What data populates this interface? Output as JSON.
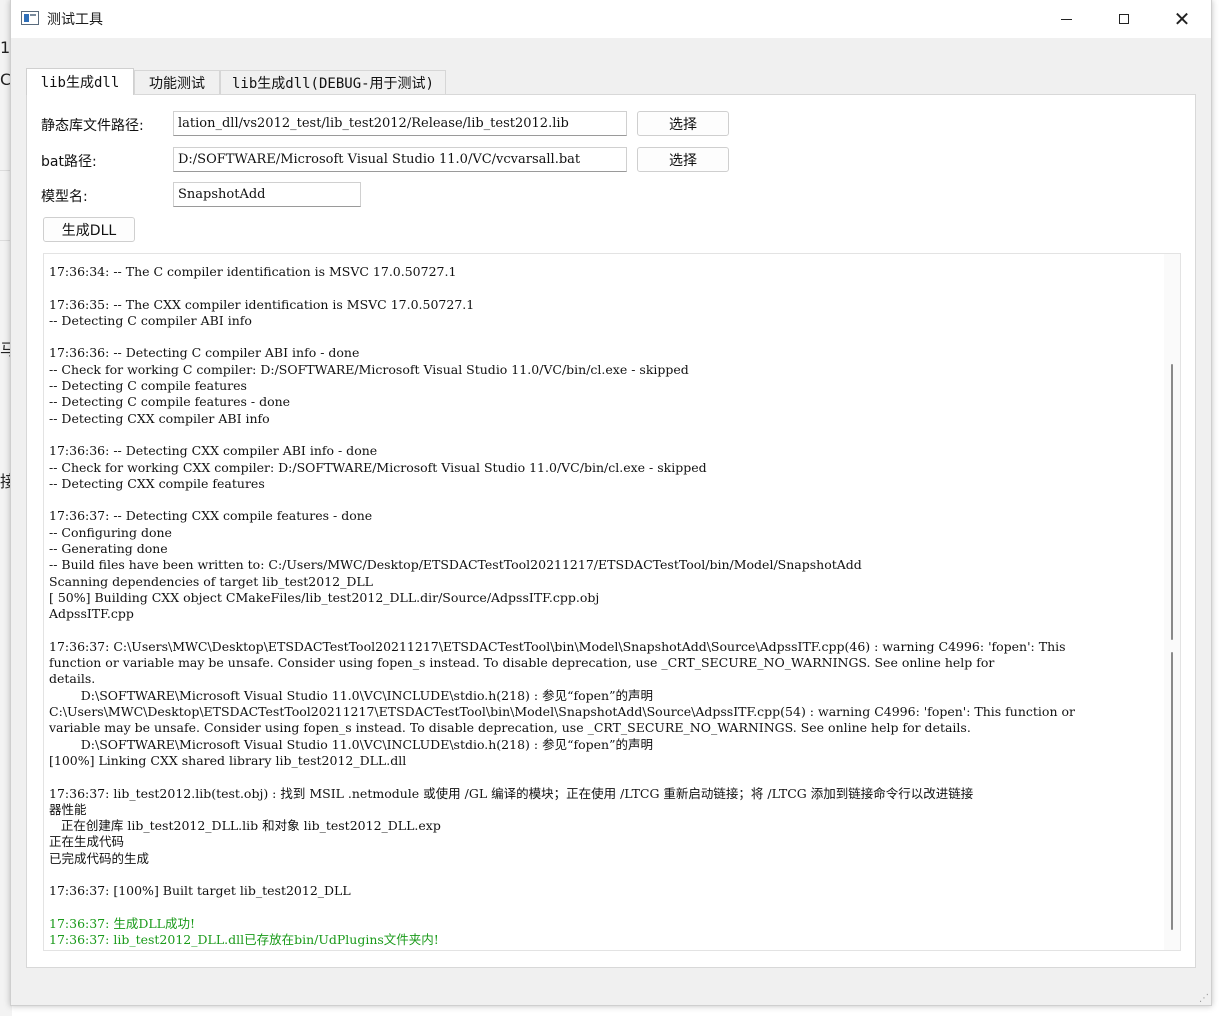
{
  "window": {
    "title": "测试工具",
    "icons": {
      "app": "app-window-icon",
      "minimize": "minimize-icon",
      "maximize": "maximize-icon",
      "close": "close-icon"
    }
  },
  "background_glyphs": [
    "1",
    "C",
    "马",
    "接"
  ],
  "tabs": [
    {
      "label": "lib生成dll",
      "active": true
    },
    {
      "label": "功能测试",
      "active": false
    },
    {
      "label": "lib生成dll(DEBUG-用于测试)",
      "active": false
    }
  ],
  "form": {
    "lib_path_label": "静态库文件路径:",
    "lib_path_value": "lation_dll/vs2012_test/lib_test2012/Release/lib_test2012.lib",
    "bat_path_label": "bat路径:",
    "bat_path_value": "D:/SOFTWARE/Microsoft Visual Studio 11.0/VC/vcvarsall.bat",
    "model_label": "模型名:",
    "model_value": "SnapshotAdd",
    "choose_label": "选择",
    "generate_label": "生成DLL"
  },
  "colors": {
    "success": "#1a9a1a"
  },
  "log": [
    {
      "text": "17:36:34: -- The C compiler identification is MSVC 17.0.50727.1",
      "color": "default"
    },
    {
      "text": "",
      "color": "default"
    },
    {
      "text": "17:36:35: -- The CXX compiler identification is MSVC 17.0.50727.1",
      "color": "default"
    },
    {
      "text": "-- Detecting C compiler ABI info",
      "color": "default"
    },
    {
      "text": "",
      "color": "default"
    },
    {
      "text": "17:36:36: -- Detecting C compiler ABI info - done",
      "color": "default"
    },
    {
      "text": "-- Check for working C compiler: D:/SOFTWARE/Microsoft Visual Studio 11.0/VC/bin/cl.exe - skipped",
      "color": "default"
    },
    {
      "text": "-- Detecting C compile features",
      "color": "default"
    },
    {
      "text": "-- Detecting C compile features - done",
      "color": "default"
    },
    {
      "text": "-- Detecting CXX compiler ABI info",
      "color": "default"
    },
    {
      "text": "",
      "color": "default"
    },
    {
      "text": "17:36:36: -- Detecting CXX compiler ABI info - done",
      "color": "default"
    },
    {
      "text": "-- Check for working CXX compiler: D:/SOFTWARE/Microsoft Visual Studio 11.0/VC/bin/cl.exe - skipped",
      "color": "default"
    },
    {
      "text": "-- Detecting CXX compile features",
      "color": "default"
    },
    {
      "text": "",
      "color": "default"
    },
    {
      "text": "17:36:37: -- Detecting CXX compile features - done",
      "color": "default"
    },
    {
      "text": "-- Configuring done",
      "color": "default"
    },
    {
      "text": "-- Generating done",
      "color": "default"
    },
    {
      "text": "-- Build files have been written to: C:/Users/MWC/Desktop/ETSDACTestTool20211217/ETSDACTestTool/bin/Model/SnapshotAdd",
      "color": "default"
    },
    {
      "text": "Scanning dependencies of target lib_test2012_DLL",
      "color": "default"
    },
    {
      "text": "[ 50%] Building CXX object CMakeFiles/lib_test2012_DLL.dir/Source/AdpssITF.cpp.obj",
      "color": "default"
    },
    {
      "text": "AdpssITF.cpp",
      "color": "default"
    },
    {
      "text": "",
      "color": "default"
    },
    {
      "text": "17:36:37: C:\\Users\\MWC\\Desktop\\ETSDACTestTool20211217\\ETSDACTestTool\\bin\\Model\\SnapshotAdd\\Source\\AdpssITF.cpp(46) : warning C4996: 'fopen': This",
      "color": "default"
    },
    {
      "text": "function or variable may be unsafe. Consider using fopen_s instead. To disable deprecation, use _CRT_SECURE_NO_WARNINGS. See online help for",
      "color": "default"
    },
    {
      "text": "details.",
      "color": "default"
    },
    {
      "text": "        D:\\SOFTWARE\\Microsoft Visual Studio 11.0\\VC\\INCLUDE\\stdio.h(218) : 参见“fopen”的声明",
      "color": "default"
    },
    {
      "text": "C:\\Users\\MWC\\Desktop\\ETSDACTestTool20211217\\ETSDACTestTool\\bin\\Model\\SnapshotAdd\\Source\\AdpssITF.cpp(54) : warning C4996: 'fopen': This function or",
      "color": "default"
    },
    {
      "text": "variable may be unsafe. Consider using fopen_s instead. To disable deprecation, use _CRT_SECURE_NO_WARNINGS. See online help for details.",
      "color": "default"
    },
    {
      "text": "        D:\\SOFTWARE\\Microsoft Visual Studio 11.0\\VC\\INCLUDE\\stdio.h(218) : 参见“fopen”的声明",
      "color": "default"
    },
    {
      "text": "[100%] Linking CXX shared library lib_test2012_DLL.dll",
      "color": "default"
    },
    {
      "text": "",
      "color": "default"
    },
    {
      "text": "17:36:37: lib_test2012.lib(test.obj) : 找到 MSIL .netmodule 或使用 /GL 编译的模块；正在使用 /LTCG 重新启动链接；将 /LTCG 添加到链接命令行以改进链接",
      "color": "default"
    },
    {
      "text": "器性能",
      "color": "default"
    },
    {
      "text": "   正在创建库 lib_test2012_DLL.lib 和对象 lib_test2012_DLL.exp",
      "color": "default"
    },
    {
      "text": "正在生成代码",
      "color": "default"
    },
    {
      "text": "已完成代码的生成",
      "color": "default"
    },
    {
      "text": "",
      "color": "default"
    },
    {
      "text": "17:36:37: [100%] Built target lib_test2012_DLL",
      "color": "default"
    },
    {
      "text": "",
      "color": "default"
    },
    {
      "text": "17:36:37: 生成DLL成功!",
      "color": "green"
    },
    {
      "text": "17:36:37: lib_test2012_DLL.dll已存放在bin/UdPlugins文件夹内!",
      "color": "green"
    }
  ]
}
